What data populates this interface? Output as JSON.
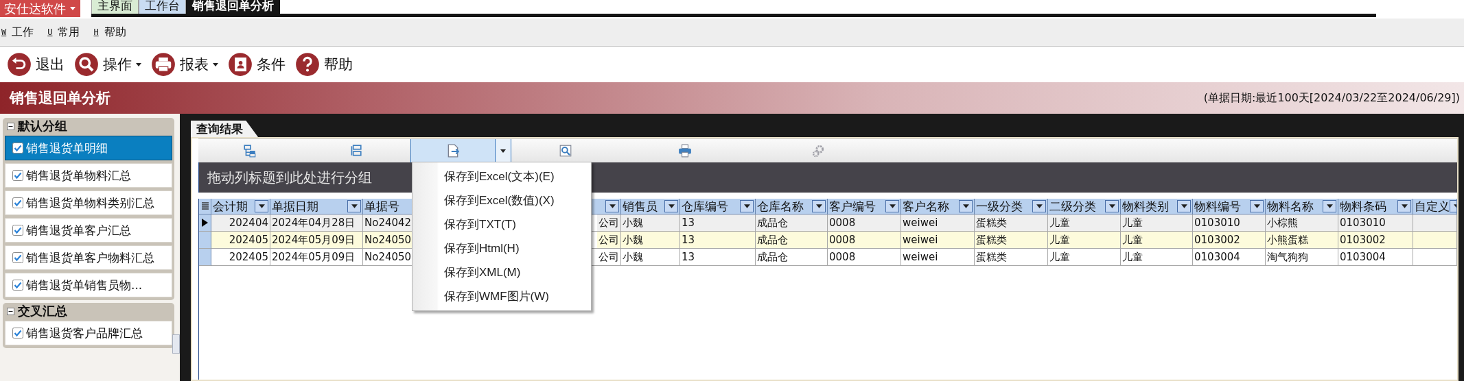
{
  "app_menu": {
    "label": "安仕达软件"
  },
  "tabs": [
    {
      "label": "主界面",
      "selected": false,
      "color": "#d9ecd4"
    },
    {
      "label": "工作台",
      "selected": false,
      "color": "#c9dcf2"
    },
    {
      "label": "销售退回单分析",
      "selected": true,
      "color": "#161616"
    }
  ],
  "menu": [
    {
      "key": "W",
      "label": "工作"
    },
    {
      "key": "U",
      "label": "常用"
    },
    {
      "key": "H",
      "label": "帮助"
    }
  ],
  "toolbar": [
    {
      "kind": "exit",
      "label": "退出",
      "dropdown": false
    },
    {
      "kind": "search",
      "label": "操作",
      "dropdown": true
    },
    {
      "kind": "print",
      "label": "报表",
      "dropdown": true
    },
    {
      "kind": "card",
      "label": "条件",
      "dropdown": false
    },
    {
      "kind": "help",
      "label": "帮助",
      "dropdown": false
    }
  ],
  "page_title": "销售退回单分析",
  "date_range": "(单据日期:最近100天[2024/03/22至2024/06/29])",
  "sidebar": {
    "groups": [
      {
        "title": "默认分组",
        "expanded": true,
        "items": [
          {
            "label": "销售退货单明细",
            "checked": true,
            "selected": true
          },
          {
            "label": "销售退货单物料汇总",
            "checked": true,
            "selected": false
          },
          {
            "label": "销售退货单物料类别汇总",
            "checked": true,
            "selected": false
          },
          {
            "label": "销售退货单客户汇总",
            "checked": true,
            "selected": false
          },
          {
            "label": "销售退货单客户物料汇总",
            "checked": true,
            "selected": false
          },
          {
            "label": "销售退货单销售员物...",
            "checked": true,
            "selected": false
          }
        ]
      },
      {
        "title": "交叉汇总",
        "expanded": true,
        "items": [
          {
            "label": "销售退货客户品牌汇总",
            "checked": true,
            "selected": false
          }
        ]
      }
    ]
  },
  "results_tab": "查询结果",
  "grid_toolbar": [
    {
      "kind": "expand",
      "pressed": false,
      "disabled": false
    },
    {
      "kind": "collapse",
      "pressed": false,
      "disabled": false
    },
    {
      "kind": "export",
      "pressed": true,
      "disabled": false
    },
    {
      "kind": "preview",
      "pressed": false,
      "disabled": false
    },
    {
      "kind": "print",
      "pressed": false,
      "disabled": false
    },
    {
      "kind": "gear",
      "pressed": false,
      "disabled": true
    }
  ],
  "group_panel": "拖动列标题到此处进行分组",
  "table": {
    "columns": [
      {
        "label": "会计期"
      },
      {
        "label": "单据日期"
      },
      {
        "label": "单据号"
      },
      {},
      {
        "label": "销售员"
      },
      {
        "label": "仓库编号"
      },
      {
        "label": "仓库名称"
      },
      {
        "label": "客户编号"
      },
      {
        "label": "客户名称"
      },
      {
        "label": "一级分类"
      },
      {
        "label": "二级分类"
      },
      {
        "label": "物料类别"
      },
      {
        "label": "物料编号"
      },
      {
        "label": "物料名称"
      },
      {
        "label": "物料条码"
      },
      {
        "label": "自定义"
      }
    ],
    "rows": [
      {
        "current": true,
        "selected": false,
        "cells": [
          "202404",
          "2024年04月28日",
          "No24042",
          "公司",
          "小魏",
          "13",
          "成品仓",
          "0008",
          "weiwei",
          "蛋糕类",
          "儿童",
          "儿童",
          "0103010",
          "小棕熊",
          "0103010"
        ]
      },
      {
        "current": false,
        "selected": true,
        "cells": [
          "202405",
          "2024年05月09日",
          "No24050",
          "公司",
          "小魏",
          "13",
          "成品仓",
          "0008",
          "weiwei",
          "蛋糕类",
          "儿童",
          "儿童",
          "0103002",
          "小熊蛋糕",
          "0103002"
        ]
      },
      {
        "current": false,
        "selected": false,
        "cells": [
          "202405",
          "2024年05月09日",
          "No24050",
          "公司",
          "小魏",
          "13",
          "成品仓",
          "0008",
          "weiwei",
          "蛋糕类",
          "儿童",
          "儿童",
          "0103004",
          "淘气狗狗",
          "0103004"
        ]
      }
    ]
  },
  "export_menu": {
    "items": [
      "保存到Excel(文本)(E)",
      "保存到Excel(数值)(X)",
      "保存到TXT(T)",
      "保存到Html(H)",
      "保存到XML(M)",
      "保存到WMF图片(W)"
    ]
  }
}
